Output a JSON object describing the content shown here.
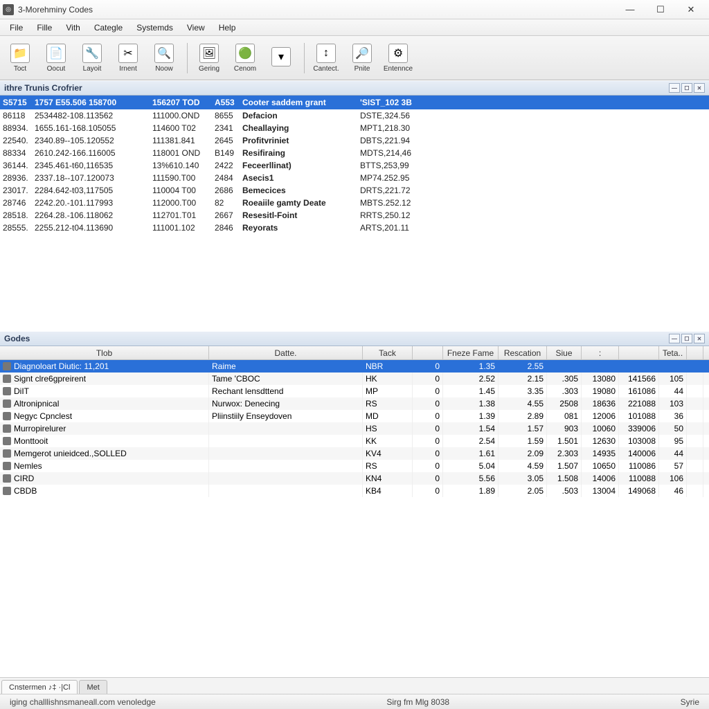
{
  "window": {
    "title": "3-Morehminy Codes"
  },
  "menu": [
    "File",
    "Fille",
    "Vith",
    "Categle",
    "Systemds",
    "View",
    "Help"
  ],
  "toolbar": [
    {
      "icon": "📁",
      "label": "Toct"
    },
    {
      "icon": "📄",
      "label": "Oocut"
    },
    {
      "icon": "🔧",
      "label": "Layoit"
    },
    {
      "icon": "✂",
      "label": "Irnent"
    },
    {
      "icon": "🔍",
      "label": "Noow"
    },
    {
      "sep": true
    },
    {
      "icon": "🖼",
      "label": "Gering"
    },
    {
      "icon": "🟢",
      "label": "Cenom"
    },
    {
      "icon": "▾",
      "label": ""
    },
    {
      "sep": true
    },
    {
      "icon": "↕",
      "label": "Cantect."
    },
    {
      "icon": "🔎",
      "label": "Pnite"
    },
    {
      "icon": "⚙",
      "label": "Entennce"
    }
  ],
  "upperPanel": {
    "title": "ithre Trunis Crofrier",
    "header": {
      "c1": "S5715",
      "c2": "1757 E55.506 158700",
      "c3": "156207 TOD",
      "c4": "A553",
      "desc": "Cooter saddem grant",
      "ref": "'SIST_102 3B"
    },
    "rows": [
      {
        "c1": "86118",
        "c2": "2534482-108.113562",
        "c3": "111000.OND",
        "c4": "8655",
        "desc": "Defacion",
        "ref": "DSTE,324.56"
      },
      {
        "c1": "88934.",
        "c2": "1655.161-168.105055",
        "c3": "114600 T02",
        "c4": "2341",
        "desc": "Cheallaying",
        "ref": "MPT1,218.30"
      },
      {
        "c1": "22540.",
        "c2": "2340.89--105.120552",
        "c3": "111381.841",
        "c4": "2645",
        "desc": "Profitvriniet",
        "ref": "DBTS,221.94"
      },
      {
        "c1": "88334",
        "c2": "2610.242-166.116005",
        "c3": "118001 OND",
        "c4": "B149",
        "desc": "Resifiraing",
        "ref": "MDTS,214,46"
      },
      {
        "c1": "36144.",
        "c2": "2345.461-t60,116535",
        "c3": "13%610.140",
        "c4": "2422",
        "desc": "Feceerllinat)",
        "ref": "BTTS,253,99"
      },
      {
        "c1": "28936.",
        "c2": "2337.18--107.120073",
        "c3": "111590.T00",
        "c4": "2484",
        "desc": "Asecis1",
        "ref": "MP74.252.95"
      },
      {
        "c1": "23017.",
        "c2": "2284.642-t03,117505",
        "c3": "110004 T00",
        "c4": "2686",
        "desc": "Bemecices",
        "ref": "DRTS,221.72"
      },
      {
        "c1": "28746",
        "c2": "2242.20.-101.117993",
        "c3": "112000.T00",
        "c4": "82",
        "desc": "Roeaiile gamty Deate",
        "ref": "MBTS.252.12"
      },
      {
        "c1": "28518.",
        "c2": "2264.28.-106.118062",
        "c3": "112701.T01",
        "c4": "2667",
        "desc": "Resesitl-Foint",
        "ref": "RRTS,250.12"
      },
      {
        "c1": "28555.",
        "c2": "2255.212-t04.113690",
        "c3": "111001.102",
        "c4": "2846",
        "desc": "Reyorats",
        "ref": "ARTS,201.11"
      }
    ]
  },
  "lowerPanel": {
    "title": "Godes",
    "columns": [
      "Tlob",
      "Datte.",
      "Tack",
      "",
      "Fneze Fame",
      "Rescation",
      "Siue",
      ":",
      "",
      "Teta..",
      ""
    ],
    "rows": [
      {
        "tob": "Diagnoloart Diutic: 11,201",
        "date": "Raime",
        "tack": "NBR",
        "z": "0",
        "fz": "1.35",
        "res": "2.55",
        "siue": "",
        "n1": "",
        "n2": "",
        "teta": "",
        "sel": true
      },
      {
        "tob": "Signt clre6gpreirent",
        "date": "Tame 'CBOC",
        "tack": "HK",
        "z": "0",
        "fz": "2.52",
        "res": "2.15",
        "siue": ".305",
        "n1": "13080",
        "n2": "141566",
        "teta": "105"
      },
      {
        "tob": "DiIT",
        "date": "Rechant lensdttend",
        "tack": "MP",
        "z": "0",
        "fz": "1.45",
        "res": "3.35",
        "siue": ".303",
        "n1": "19080",
        "n2": "161086",
        "teta": "44"
      },
      {
        "tob": "Altronipnical",
        "date": "Nurwox: Denecing",
        "tack": "RS",
        "z": "0",
        "fz": "1.38",
        "res": "4.55",
        "siue": "2508",
        "n1": "18636",
        "n2": "221088",
        "teta": "103"
      },
      {
        "tob": "Negyc Cpnclest",
        "date": "Pliinstiily Enseydoven",
        "tack": "MD",
        "z": "0",
        "fz": "1.39",
        "res": "2.89",
        "siue": "081",
        "n1": "12006",
        "n2": "101088",
        "teta": "36"
      },
      {
        "tob": "Murropirelurer",
        "date": "",
        "tack": "HS",
        "z": "0",
        "fz": "1.54",
        "res": "1.57",
        "siue": "903",
        "n1": "10060",
        "n2": "339006",
        "teta": "50"
      },
      {
        "tob": "Monttooit",
        "date": "",
        "tack": "KK",
        "z": "0",
        "fz": "2.54",
        "res": "1.59",
        "siue": "1.501",
        "n1": "12630",
        "n2": "103008",
        "teta": "95"
      },
      {
        "tob": "Memgerot unieidced.,SOLLED",
        "date": "",
        "tack": "KV4",
        "z": "0",
        "fz": "1.61",
        "res": "2.09",
        "siue": "2.303",
        "n1": "14935",
        "n2": "140006",
        "teta": "44"
      },
      {
        "tob": "Nemles",
        "date": "",
        "tack": "RS",
        "z": "0",
        "fz": "5.04",
        "res": "4.59",
        "siue": "1.507",
        "n1": "10650",
        "n2": "110086",
        "teta": "57"
      },
      {
        "tob": "CIRD",
        "date": "",
        "tack": "KN4",
        "z": "0",
        "fz": "5.56",
        "res": "3.05",
        "siue": "1.508",
        "n1": "14006",
        "n2": "110088",
        "teta": "106"
      },
      {
        "tob": "CBDB",
        "date": "",
        "tack": "KB4",
        "z": "0",
        "fz": "1.89",
        "res": "2.05",
        "siue": ".503",
        "n1": "13004",
        "n2": "149068",
        "teta": "46"
      }
    ]
  },
  "footerTabs": [
    "Cnstermen ♪‡ ·|Cl",
    "Met"
  ],
  "status": {
    "left": "iging challlishnsmaneall.com venoledge",
    "mid": "Sirg fm Mlg 8038",
    "right": "Syrie"
  }
}
